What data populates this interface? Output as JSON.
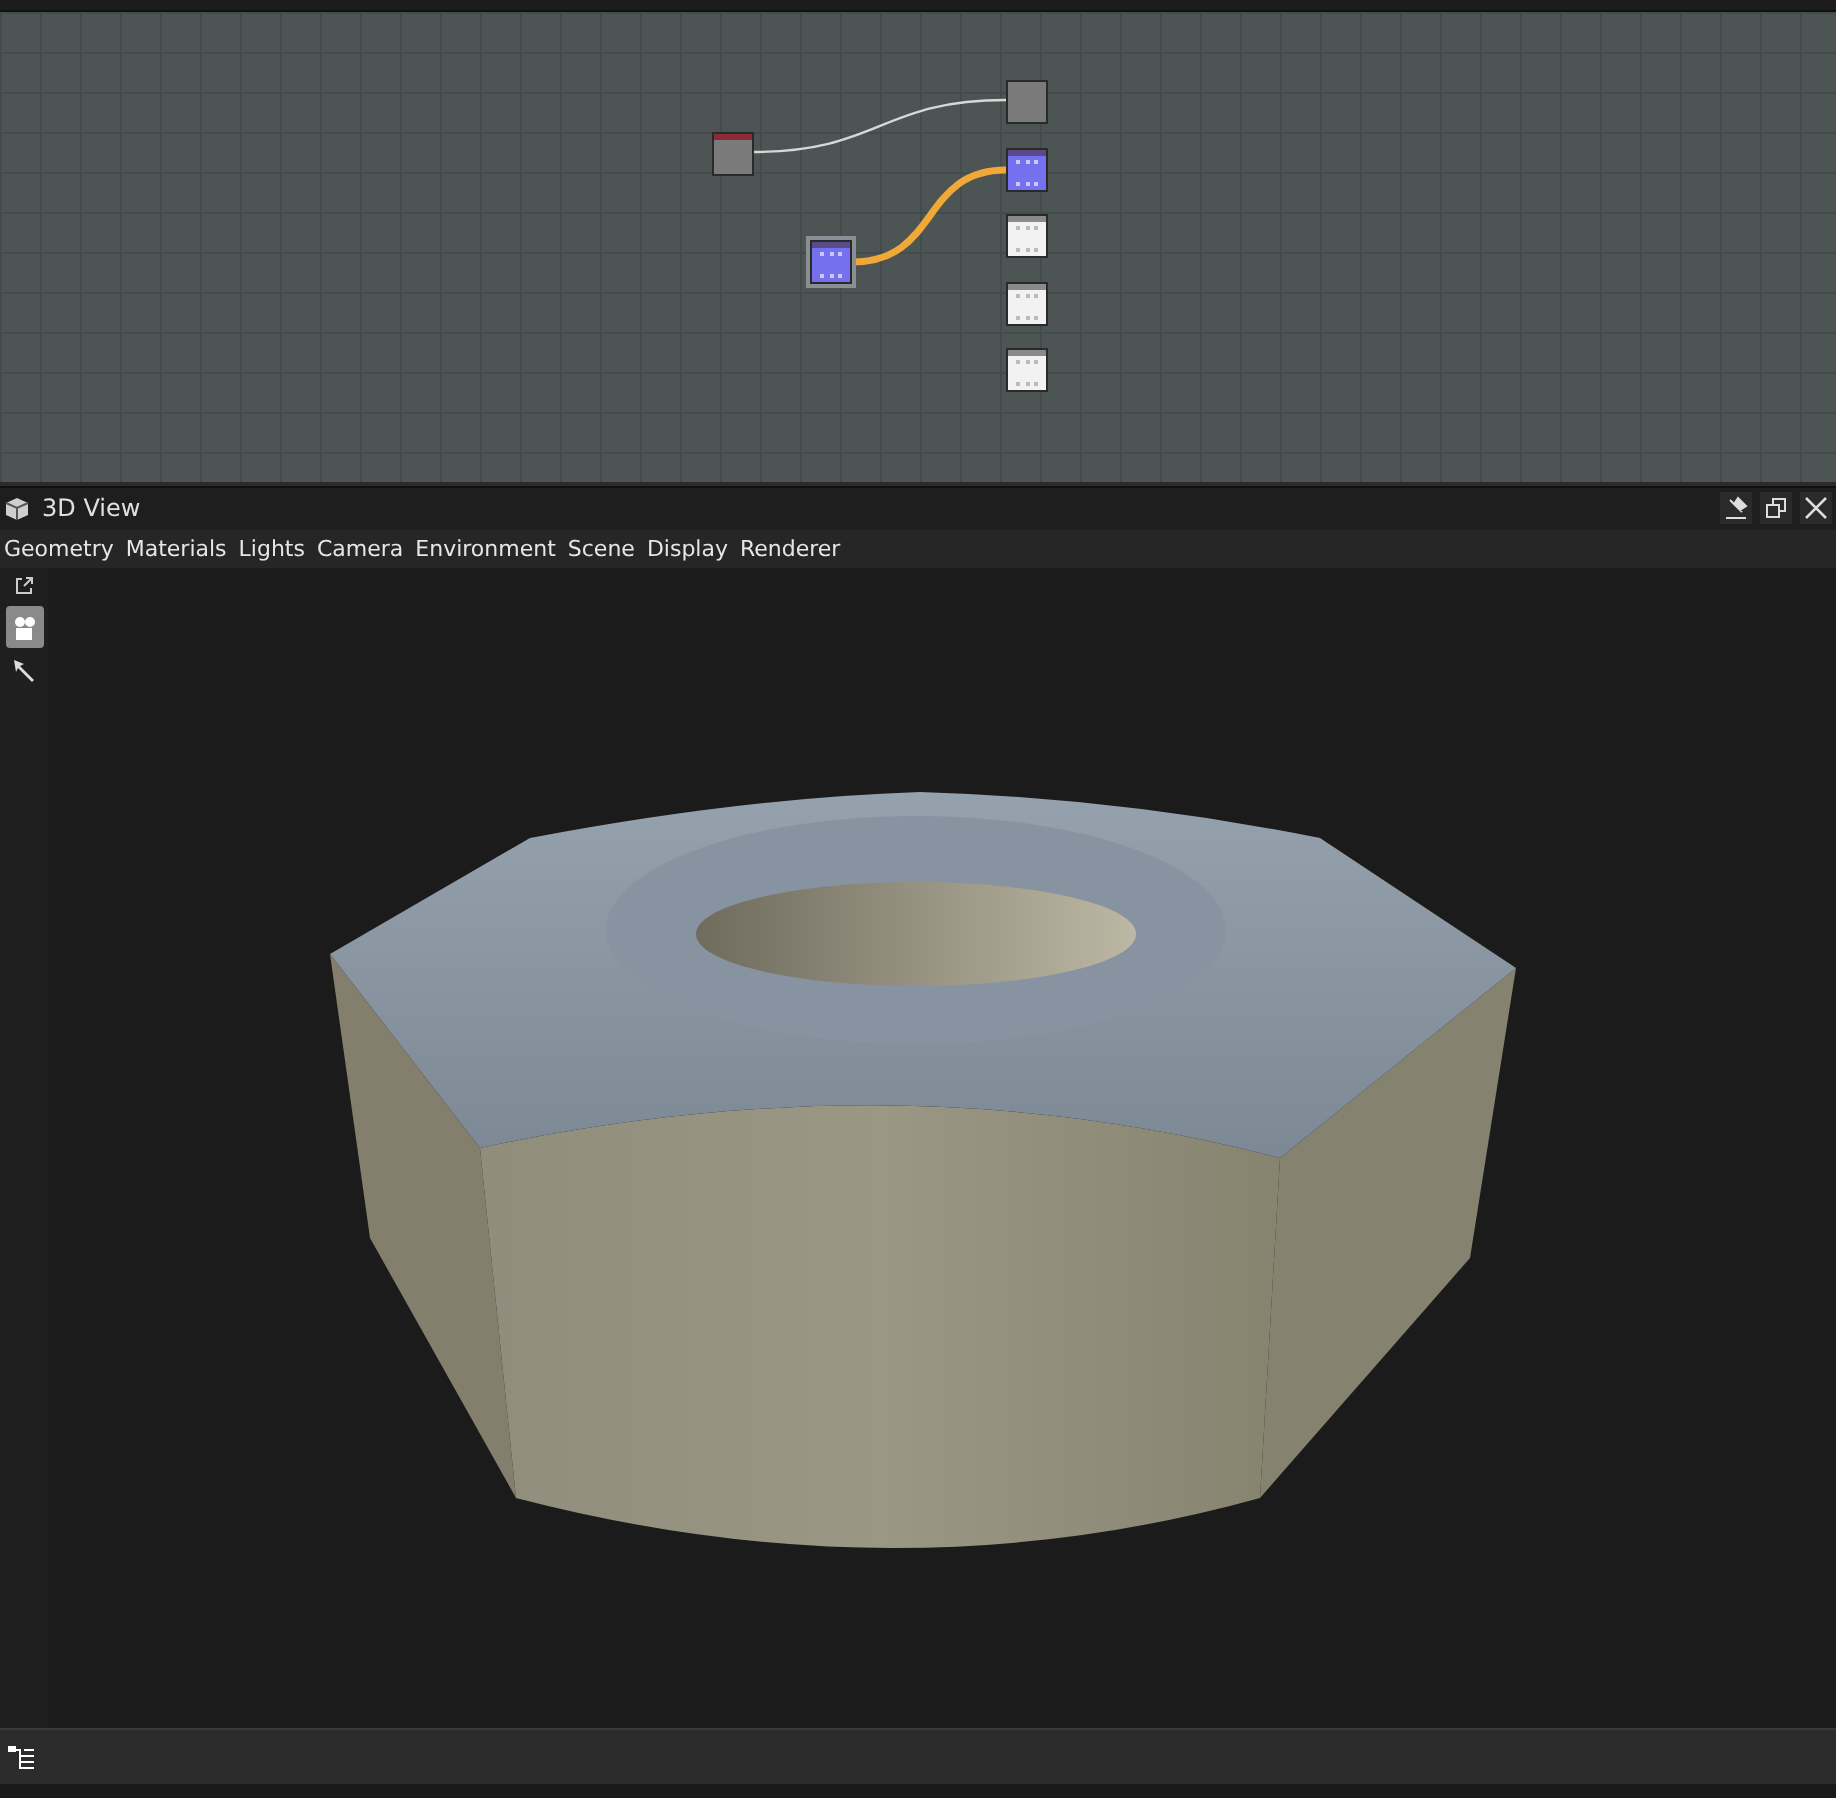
{
  "graph": {
    "nodes": [
      {
        "kind": "uniform",
        "selected": false
      },
      {
        "kind": "color",
        "selected": false
      },
      {
        "kind": "pattern",
        "selected": false
      },
      {
        "kind": "output",
        "selected": false
      },
      {
        "kind": "pattern",
        "selected": true
      },
      {
        "kind": "output",
        "selected": false
      },
      {
        "kind": "output",
        "selected": false
      }
    ]
  },
  "panel": {
    "title": "3D View"
  },
  "menu": [
    "Geometry",
    "Materials",
    "Lights",
    "Camera",
    "Environment",
    "Scene",
    "Display",
    "Renderer"
  ]
}
